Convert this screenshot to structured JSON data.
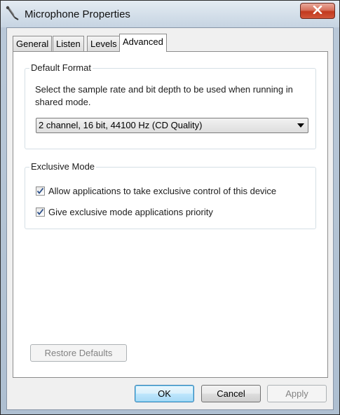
{
  "window": {
    "title": "Microphone Properties",
    "icon": "microphone-icon",
    "close_icon": "close-icon"
  },
  "tabs": [
    {
      "label": "General",
      "active": false
    },
    {
      "label": "Listen",
      "active": false
    },
    {
      "label": "Levels",
      "active": false
    },
    {
      "label": "Advanced",
      "active": true
    }
  ],
  "default_format": {
    "group_label": "Default Format",
    "description": "Select the sample rate and bit depth to be used when running in shared mode.",
    "selected_value": "2 channel, 16 bit, 44100 Hz (CD Quality)"
  },
  "exclusive_mode": {
    "group_label": "Exclusive Mode",
    "options": [
      {
        "label": "Allow applications to take exclusive control of this device",
        "checked": true
      },
      {
        "label": "Give exclusive mode applications priority",
        "checked": true
      }
    ]
  },
  "buttons": {
    "restore_defaults": "Restore Defaults",
    "ok": "OK",
    "cancel": "Cancel",
    "apply": "Apply"
  },
  "colors": {
    "close_button": "#c2391e",
    "check": "#2b4f8a"
  }
}
